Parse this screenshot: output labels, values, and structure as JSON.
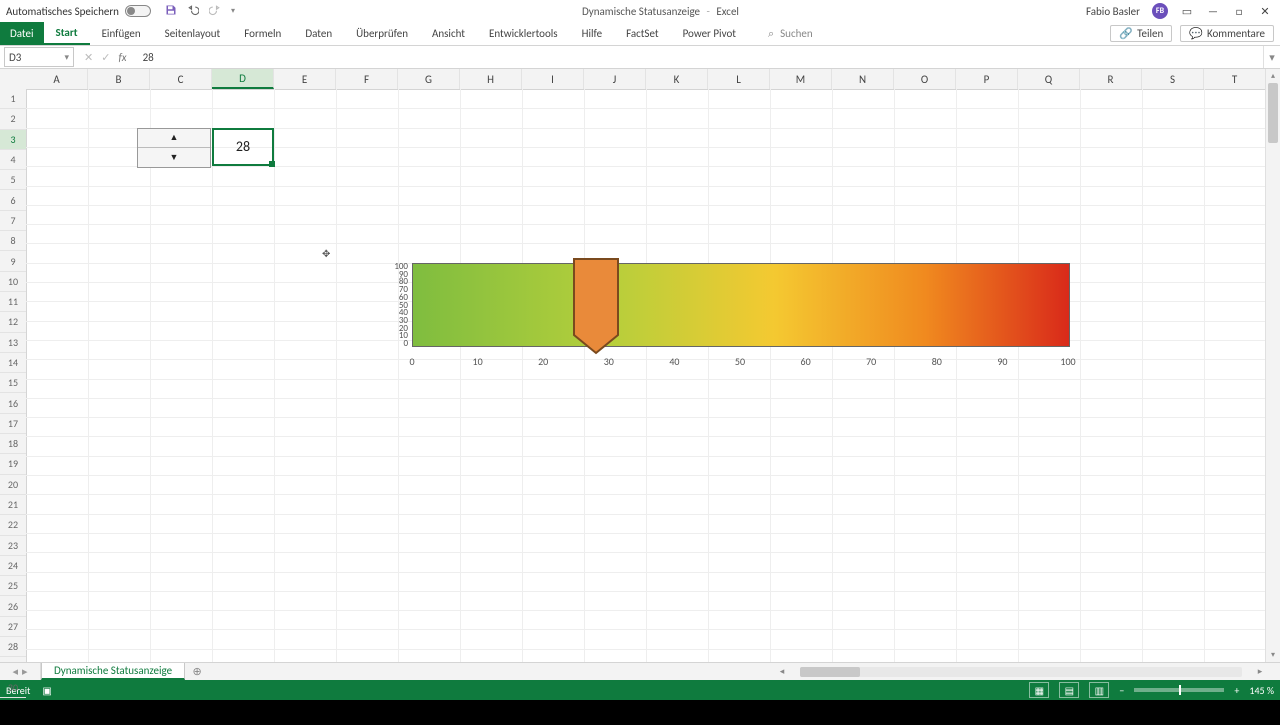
{
  "titlebar": {
    "autosave_label": "Automatisches Speichern",
    "doc_title": "Dynamische Statusanzeige",
    "app_name": "Excel",
    "user_name": "Fabio Basler",
    "user_initials": "FB"
  },
  "ribbon": {
    "file": "Datei",
    "tabs": [
      "Start",
      "Einfügen",
      "Seitenlayout",
      "Formeln",
      "Daten",
      "Überprüfen",
      "Ansicht",
      "Entwicklertools",
      "Hilfe",
      "FactSet",
      "Power Pivot"
    ],
    "selected": 0,
    "search_placeholder": "Suchen",
    "share": "Teilen",
    "comments": "Kommentare"
  },
  "formula_bar": {
    "cell_ref": "D3",
    "value": "28"
  },
  "grid": {
    "columns": [
      "A",
      "B",
      "C",
      "D",
      "E",
      "F",
      "G",
      "H",
      "I",
      "J",
      "K",
      "L",
      "M",
      "N",
      "O",
      "P",
      "Q",
      "R",
      "S",
      "T"
    ],
    "selected_col": 3,
    "rows": 30,
    "selected_row": 3,
    "active_value": "28"
  },
  "chart_data": {
    "type": "bar",
    "title": "",
    "xlabel": "",
    "ylabel": "",
    "xlim": [
      0,
      100
    ],
    "ylim": [
      0,
      100
    ],
    "x_ticks": [
      0,
      10,
      20,
      30,
      40,
      50,
      60,
      70,
      80,
      90,
      100
    ],
    "y_ticks": [
      0,
      10,
      20,
      30,
      40,
      50,
      60,
      70,
      80,
      90,
      100
    ],
    "marker_value": 28,
    "gradient_stops": [
      {
        "pct": 0,
        "color": "#7fbd3f"
      },
      {
        "pct": 30,
        "color": "#b6cf3b"
      },
      {
        "pct": 55,
        "color": "#f4c931"
      },
      {
        "pct": 78,
        "color": "#f08a1f"
      },
      {
        "pct": 100,
        "color": "#d92a1a"
      }
    ],
    "marker_fill": "#e98a3a",
    "marker_stroke": "#7a4a1e"
  },
  "sheet_tabs": {
    "active": "Dynamische Statusanzeige"
  },
  "status": {
    "ready": "Bereit",
    "zoom": "145 %"
  },
  "icons": {
    "save": "save-icon",
    "undo": "undo-icon",
    "redo": "redo-icon",
    "min": "—",
    "max": "□",
    "close": "✕",
    "ribbon_mode": "▭",
    "search": "⌕",
    "share": "⇪",
    "comment": "💬",
    "chev_down": "▾",
    "chev_up": "▴",
    "chev_left": "◂",
    "chev_right": "▸",
    "plus": "⊕",
    "minus": "−",
    "rec": "●"
  }
}
